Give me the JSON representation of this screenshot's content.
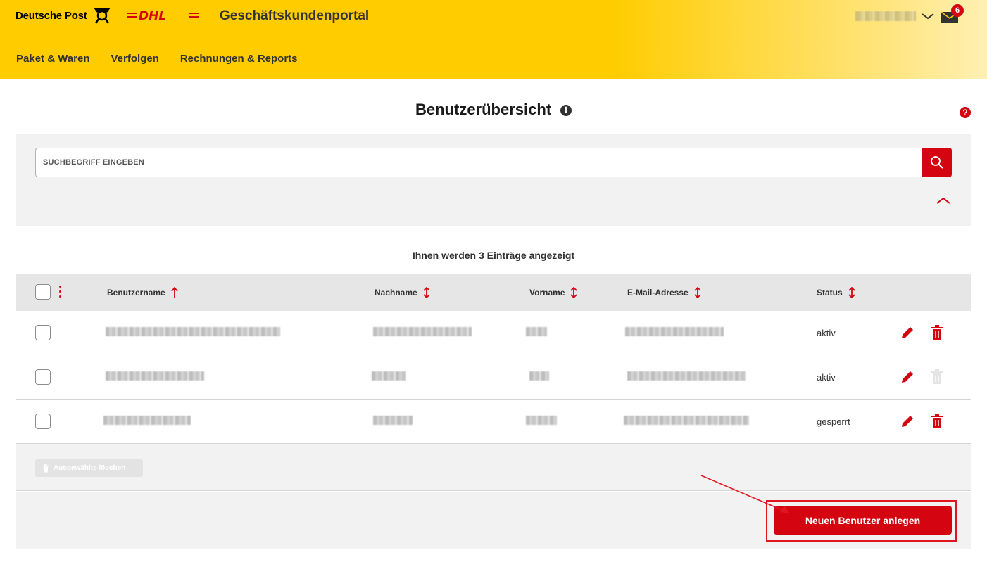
{
  "header": {
    "brand": "Deutsche Post",
    "dhl_logo": "DHL",
    "portal_title": "Geschäftskundenportal",
    "nav": [
      "Paket & Waren",
      "Verfolgen",
      "Rechnungen & Reports"
    ],
    "mail_badge": "6",
    "icons": [
      "posthorn-icon",
      "dhl-logo",
      "chevron-down-icon",
      "mail-icon"
    ]
  },
  "page": {
    "title": "Benutzerübersicht",
    "info_icon": "i",
    "help_icon": "?"
  },
  "search": {
    "placeholder": "SUCHBEGRIFF EINGEBEN",
    "value": ""
  },
  "results": {
    "count_text": "Ihnen werden 3 Einträge angezeigt"
  },
  "table": {
    "columns": [
      "Benutzername",
      "Nachname",
      "Vorname",
      "E-Mail-Adresse",
      "Status"
    ],
    "rows": [
      {
        "status": "aktiv",
        "delete_enabled": true
      },
      {
        "status": "aktiv",
        "delete_enabled": false
      },
      {
        "status": "gesperrt",
        "delete_enabled": true
      }
    ]
  },
  "actions": {
    "delete_selected": "Ausgewählte löschen",
    "new_user": "Neuen Benutzer anlegen"
  },
  "colors": {
    "brand_yellow": "#ffcc00",
    "brand_red": "#d40511",
    "panel_grey": "#f2f2f2",
    "header_grey": "#e6e6e6"
  }
}
